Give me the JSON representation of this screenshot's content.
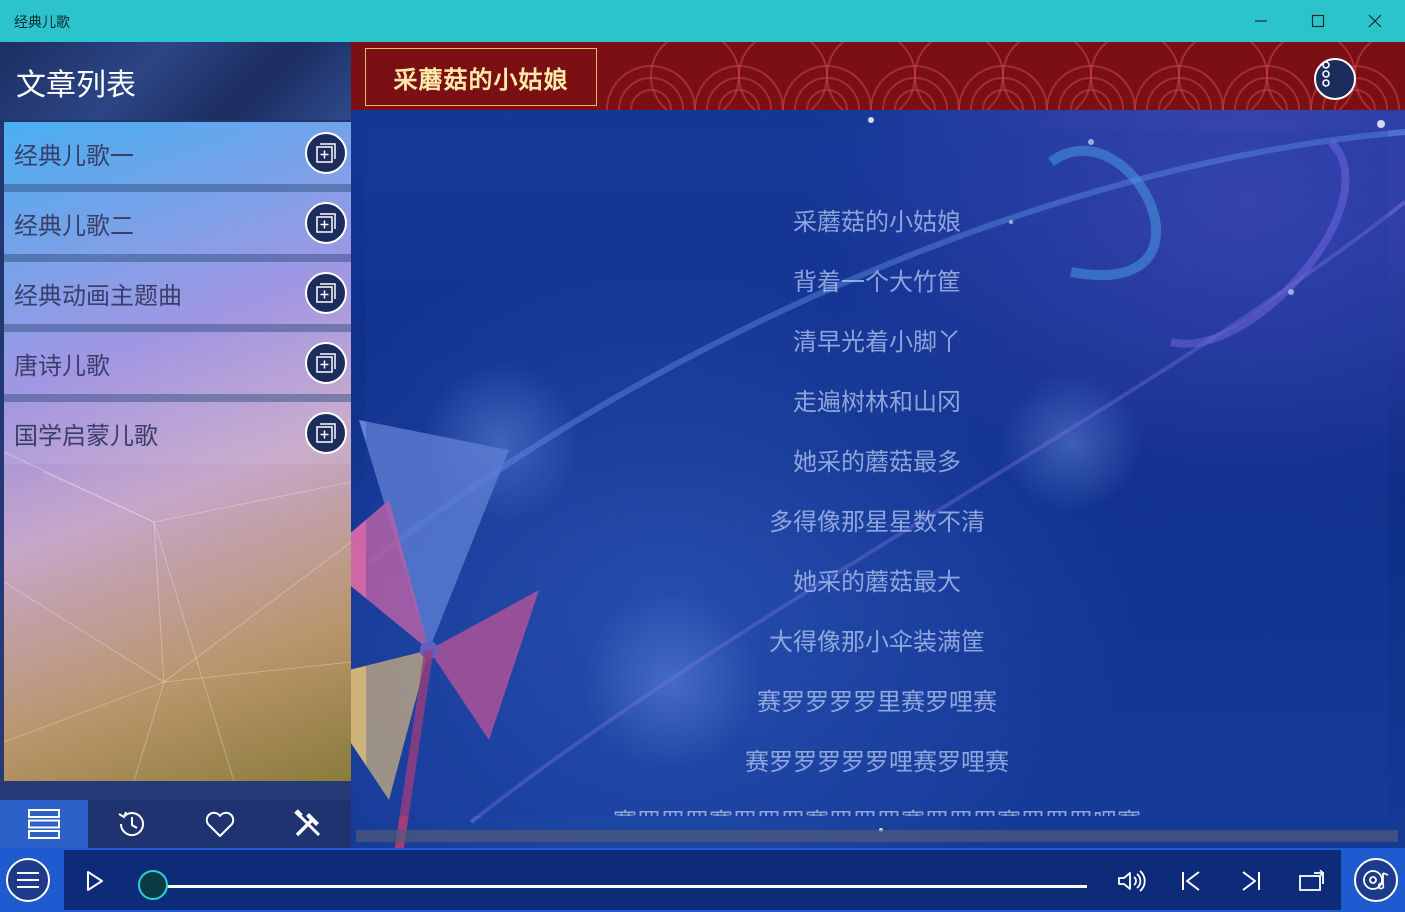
{
  "window": {
    "title": "经典儿歌",
    "minimize_icon": "minimize-icon",
    "maximize_icon": "maximize-icon",
    "close_icon": "close-icon"
  },
  "sidebar": {
    "header": "文章列表",
    "items": [
      {
        "label": "经典儿歌一",
        "icon": "add-to-collection-icon"
      },
      {
        "label": "经典儿歌二",
        "icon": "add-to-collection-icon"
      },
      {
        "label": "经典动画主题曲",
        "icon": "add-to-collection-icon"
      },
      {
        "label": "唐诗儿歌",
        "icon": "add-to-collection-icon"
      },
      {
        "label": "国学启蒙儿歌",
        "icon": "add-to-collection-icon"
      }
    ],
    "tabs": [
      {
        "name": "list",
        "icon": "list-icon",
        "active": true
      },
      {
        "name": "history",
        "icon": "history-icon",
        "active": false
      },
      {
        "name": "favorites",
        "icon": "heart-icon",
        "active": false
      },
      {
        "name": "tools",
        "icon": "tools-icon",
        "active": false
      }
    ]
  },
  "content": {
    "song_title": "采蘑菇的小姑娘",
    "more_icon": "more-vertical-icon",
    "lyrics": [
      "采蘑菇的小姑娘",
      "背着一个大竹筐",
      "清早光着小脚丫",
      "走遍树林和山冈",
      "她采的蘑菇最多",
      "多得像那星星数不清",
      "她采的蘑菇最大",
      "大得像那小伞装满筐",
      "赛罗罗罗罗里赛罗哩赛",
      "赛罗罗罗罗罗哩赛罗哩赛",
      "赛罗罗罗赛罗罗罗赛罗罗罗赛罗罗罗赛罗罗罗哩赛"
    ]
  },
  "player": {
    "menu_icon": "hamburger-menu-icon",
    "play_icon": "play-icon",
    "progress": 0.0,
    "volume_icon": "volume-icon",
    "previous_icon": "previous-track-icon",
    "next_icon": "next-track-icon",
    "repeat_icon": "repeat-icon",
    "disc_icon": "music-disc-icon"
  },
  "colors": {
    "titlebar": "#2cc4cc",
    "banner": "#7a0f14",
    "banner_text": "#ffe9a8",
    "player_bar": "#1e5bd0",
    "active_tab": "#2c61c9"
  }
}
